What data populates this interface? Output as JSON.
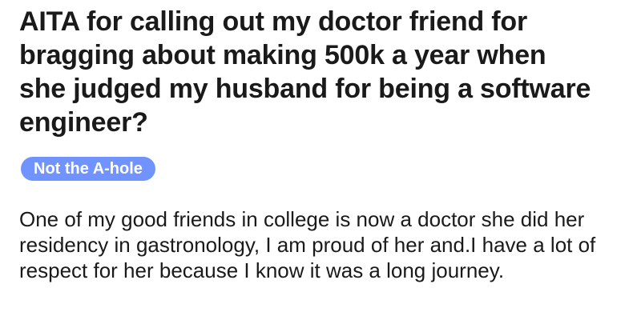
{
  "post": {
    "title": "AITA for calling out my doctor friend for bragging about making 500k a year when she judged my husband for being a software engineer?",
    "flair": {
      "label": "Not the A-hole",
      "color": "#7193ff"
    },
    "body": "One of my good friends in college is now a doctor she did her residency in gastronology, I am proud of her and.I have a lot of respect for her because I know it was a long journey."
  }
}
